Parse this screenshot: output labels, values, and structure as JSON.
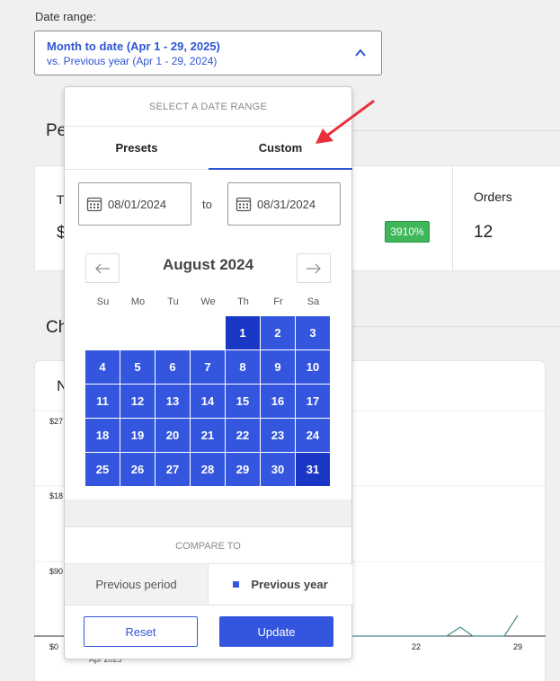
{
  "date_range": {
    "label": "Date range:",
    "selected_main": "Month to date (Apr 1 - 29, 2025)",
    "selected_compare": "vs. Previous year (Apr 1 - 29, 2024)"
  },
  "background": {
    "section_frag_1": "Pe",
    "section_frag_2": "Ch",
    "stat_frag_title": "T",
    "stat_frag_value": "$",
    "badge": "3910%",
    "orders_label": "Orders",
    "orders_value": "12",
    "chart_frag_title": "N",
    "y_ticks": [
      "$27",
      "$18",
      "$90",
      "$0"
    ],
    "x_ticks": [
      "22",
      "29"
    ],
    "x_sub": "Apr 2025"
  },
  "picker": {
    "header": "SELECT A DATE RANGE",
    "tabs": [
      "Presets",
      "Custom"
    ],
    "active_tab": "Custom",
    "start_date": "08/01/2024",
    "to_label": "to",
    "end_date": "08/31/2024",
    "month_title": "August 2024",
    "prev_icon": "arrow-left-icon",
    "next_icon": "arrow-right-icon",
    "weekdays": [
      "Su",
      "Mo",
      "Tu",
      "We",
      "Th",
      "Fr",
      "Sa"
    ],
    "days": [
      "1",
      "2",
      "3",
      "4",
      "5",
      "6",
      "7",
      "8",
      "9",
      "10",
      "11",
      "12",
      "13",
      "14",
      "15",
      "16",
      "17",
      "18",
      "19",
      "20",
      "21",
      "22",
      "23",
      "24",
      "25",
      "26",
      "27",
      "28",
      "29",
      "30",
      "31"
    ],
    "compare_header": "COMPARE TO",
    "compare_options": [
      "Previous period",
      "Previous year"
    ],
    "compare_selected": "Previous year",
    "reset_label": "Reset",
    "update_label": "Update"
  },
  "colors": {
    "accent": "#3456de",
    "range_edge": "#1a36c4",
    "badge": "#3fb65a",
    "annotation_arrow": "#e8313a"
  }
}
